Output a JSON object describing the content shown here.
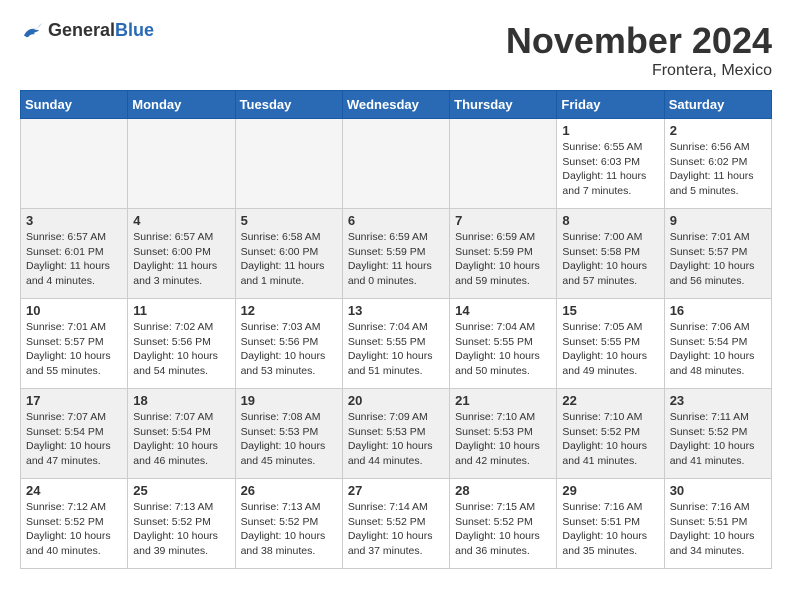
{
  "header": {
    "logo_general": "General",
    "logo_blue": "Blue",
    "month_title": "November 2024",
    "location": "Frontera, Mexico"
  },
  "days_of_week": [
    "Sunday",
    "Monday",
    "Tuesday",
    "Wednesday",
    "Thursday",
    "Friday",
    "Saturday"
  ],
  "weeks": [
    {
      "days": [
        {
          "num": "",
          "info": "",
          "empty": true
        },
        {
          "num": "",
          "info": "",
          "empty": true
        },
        {
          "num": "",
          "info": "",
          "empty": true
        },
        {
          "num": "",
          "info": "",
          "empty": true
        },
        {
          "num": "",
          "info": "",
          "empty": true
        },
        {
          "num": "1",
          "info": "Sunrise: 6:55 AM\nSunset: 6:03 PM\nDaylight: 11 hours\nand 7 minutes.",
          "empty": false
        },
        {
          "num": "2",
          "info": "Sunrise: 6:56 AM\nSunset: 6:02 PM\nDaylight: 11 hours\nand 5 minutes.",
          "empty": false
        }
      ]
    },
    {
      "days": [
        {
          "num": "3",
          "info": "Sunrise: 6:57 AM\nSunset: 6:01 PM\nDaylight: 11 hours\nand 4 minutes.",
          "empty": false
        },
        {
          "num": "4",
          "info": "Sunrise: 6:57 AM\nSunset: 6:00 PM\nDaylight: 11 hours\nand 3 minutes.",
          "empty": false
        },
        {
          "num": "5",
          "info": "Sunrise: 6:58 AM\nSunset: 6:00 PM\nDaylight: 11 hours\nand 1 minute.",
          "empty": false
        },
        {
          "num": "6",
          "info": "Sunrise: 6:59 AM\nSunset: 5:59 PM\nDaylight: 11 hours\nand 0 minutes.",
          "empty": false
        },
        {
          "num": "7",
          "info": "Sunrise: 6:59 AM\nSunset: 5:59 PM\nDaylight: 10 hours\nand 59 minutes.",
          "empty": false
        },
        {
          "num": "8",
          "info": "Sunrise: 7:00 AM\nSunset: 5:58 PM\nDaylight: 10 hours\nand 57 minutes.",
          "empty": false
        },
        {
          "num": "9",
          "info": "Sunrise: 7:01 AM\nSunset: 5:57 PM\nDaylight: 10 hours\nand 56 minutes.",
          "empty": false
        }
      ]
    },
    {
      "days": [
        {
          "num": "10",
          "info": "Sunrise: 7:01 AM\nSunset: 5:57 PM\nDaylight: 10 hours\nand 55 minutes.",
          "empty": false
        },
        {
          "num": "11",
          "info": "Sunrise: 7:02 AM\nSunset: 5:56 PM\nDaylight: 10 hours\nand 54 minutes.",
          "empty": false
        },
        {
          "num": "12",
          "info": "Sunrise: 7:03 AM\nSunset: 5:56 PM\nDaylight: 10 hours\nand 53 minutes.",
          "empty": false
        },
        {
          "num": "13",
          "info": "Sunrise: 7:04 AM\nSunset: 5:55 PM\nDaylight: 10 hours\nand 51 minutes.",
          "empty": false
        },
        {
          "num": "14",
          "info": "Sunrise: 7:04 AM\nSunset: 5:55 PM\nDaylight: 10 hours\nand 50 minutes.",
          "empty": false
        },
        {
          "num": "15",
          "info": "Sunrise: 7:05 AM\nSunset: 5:55 PM\nDaylight: 10 hours\nand 49 minutes.",
          "empty": false
        },
        {
          "num": "16",
          "info": "Sunrise: 7:06 AM\nSunset: 5:54 PM\nDaylight: 10 hours\nand 48 minutes.",
          "empty": false
        }
      ]
    },
    {
      "days": [
        {
          "num": "17",
          "info": "Sunrise: 7:07 AM\nSunset: 5:54 PM\nDaylight: 10 hours\nand 47 minutes.",
          "empty": false
        },
        {
          "num": "18",
          "info": "Sunrise: 7:07 AM\nSunset: 5:54 PM\nDaylight: 10 hours\nand 46 minutes.",
          "empty": false
        },
        {
          "num": "19",
          "info": "Sunrise: 7:08 AM\nSunset: 5:53 PM\nDaylight: 10 hours\nand 45 minutes.",
          "empty": false
        },
        {
          "num": "20",
          "info": "Sunrise: 7:09 AM\nSunset: 5:53 PM\nDaylight: 10 hours\nand 44 minutes.",
          "empty": false
        },
        {
          "num": "21",
          "info": "Sunrise: 7:10 AM\nSunset: 5:53 PM\nDaylight: 10 hours\nand 42 minutes.",
          "empty": false
        },
        {
          "num": "22",
          "info": "Sunrise: 7:10 AM\nSunset: 5:52 PM\nDaylight: 10 hours\nand 41 minutes.",
          "empty": false
        },
        {
          "num": "23",
          "info": "Sunrise: 7:11 AM\nSunset: 5:52 PM\nDaylight: 10 hours\nand 41 minutes.",
          "empty": false
        }
      ]
    },
    {
      "days": [
        {
          "num": "24",
          "info": "Sunrise: 7:12 AM\nSunset: 5:52 PM\nDaylight: 10 hours\nand 40 minutes.",
          "empty": false
        },
        {
          "num": "25",
          "info": "Sunrise: 7:13 AM\nSunset: 5:52 PM\nDaylight: 10 hours\nand 39 minutes.",
          "empty": false
        },
        {
          "num": "26",
          "info": "Sunrise: 7:13 AM\nSunset: 5:52 PM\nDaylight: 10 hours\nand 38 minutes.",
          "empty": false
        },
        {
          "num": "27",
          "info": "Sunrise: 7:14 AM\nSunset: 5:52 PM\nDaylight: 10 hours\nand 37 minutes.",
          "empty": false
        },
        {
          "num": "28",
          "info": "Sunrise: 7:15 AM\nSunset: 5:52 PM\nDaylight: 10 hours\nand 36 minutes.",
          "empty": false
        },
        {
          "num": "29",
          "info": "Sunrise: 7:16 AM\nSunset: 5:51 PM\nDaylight: 10 hours\nand 35 minutes.",
          "empty": false
        },
        {
          "num": "30",
          "info": "Sunrise: 7:16 AM\nSunset: 5:51 PM\nDaylight: 10 hours\nand 34 minutes.",
          "empty": false
        }
      ]
    }
  ]
}
